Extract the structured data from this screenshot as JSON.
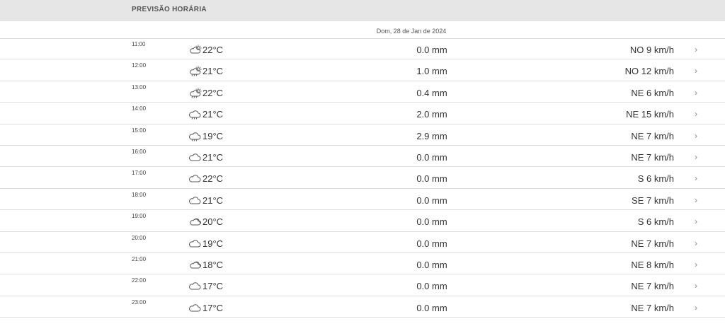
{
  "header": {
    "title": "PREVISÃO HORÁRIA"
  },
  "date": "Dom, 28 de Jan de 2024",
  "colors": {
    "header_bg": "#e6e6e6",
    "divider": "#dddddd",
    "text": "#333333"
  },
  "rows": [
    {
      "time": "11:00",
      "icon": "partly-sunny-cloud-icon",
      "temp": "22°C",
      "precip": "0.0 mm",
      "wind": "NO 9 km/h"
    },
    {
      "time": "12:00",
      "icon": "sun-cloud-rain-icon",
      "temp": "21°C",
      "precip": "1.0 mm",
      "wind": "NO 12 km/h"
    },
    {
      "time": "13:00",
      "icon": "sun-cloud-rain-icon",
      "temp": "22°C",
      "precip": "0.4 mm",
      "wind": "NE 6 km/h"
    },
    {
      "time": "14:00",
      "icon": "cloud-rain-icon",
      "temp": "21°C",
      "precip": "2.0 mm",
      "wind": "NE 15 km/h"
    },
    {
      "time": "15:00",
      "icon": "cloud-rain-icon",
      "temp": "19°C",
      "precip": "2.9 mm",
      "wind": "NE 7 km/h"
    },
    {
      "time": "16:00",
      "icon": "cloud-icon",
      "temp": "21°C",
      "precip": "0.0 mm",
      "wind": "NE 7 km/h"
    },
    {
      "time": "17:00",
      "icon": "cloud-icon",
      "temp": "22°C",
      "precip": "0.0 mm",
      "wind": "S 6 km/h"
    },
    {
      "time": "18:00",
      "icon": "cloud-icon",
      "temp": "21°C",
      "precip": "0.0 mm",
      "wind": "SE 7 km/h"
    },
    {
      "time": "19:00",
      "icon": "clouds-icon",
      "temp": "20°C",
      "precip": "0.0 mm",
      "wind": "S 6 km/h"
    },
    {
      "time": "20:00",
      "icon": "cloud-icon",
      "temp": "19°C",
      "precip": "0.0 mm",
      "wind": "NE 7 km/h"
    },
    {
      "time": "21:00",
      "icon": "clouds-icon",
      "temp": "18°C",
      "precip": "0.0 mm",
      "wind": "NE 8 km/h"
    },
    {
      "time": "22:00",
      "icon": "cloud-icon",
      "temp": "17°C",
      "precip": "0.0 mm",
      "wind": "NE 7 km/h"
    },
    {
      "time": "23:00",
      "icon": "cloud-icon",
      "temp": "17°C",
      "precip": "0.0 mm",
      "wind": "NE 7 km/h"
    }
  ],
  "chevron": "›"
}
